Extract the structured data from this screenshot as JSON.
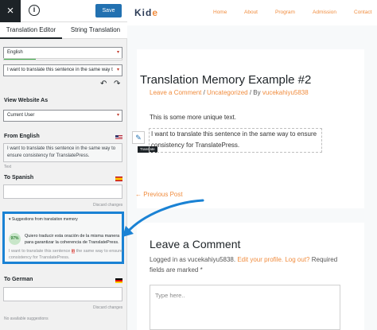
{
  "editor": {
    "close_icon": "×",
    "info_icon": "i",
    "save_label": "Save",
    "tabs": [
      {
        "label": "Translation Editor"
      },
      {
        "label": "String Translation"
      }
    ],
    "language_select": "English",
    "language_progress": 0.27,
    "string_select": "I want to translate this sentence in the same way t",
    "undo_icon": "↶",
    "redo_icon": "↷",
    "view_as_label": "View Website As",
    "view_as_value": "Current User",
    "from_label": "From English",
    "from_text": "I want to translate this sentence in the same way to ensure consistency for TranslatePress.",
    "from_type": "Text",
    "to_spanish_label": "To Spanish",
    "to_spanish_value": "",
    "discard_label": "Discard changes",
    "suggestions": {
      "title": "▾ Suggestions from translation memory",
      "percent": "97%",
      "translation": "Quiero traducir esta oración de la misma manera para garantizar la coherencia de TranslatePress.",
      "source_before": "I want to translate this sentence ",
      "source_highlight": "in",
      "source_after": " the same way to ensure consistency for TranslatePress."
    },
    "to_german_label": "To German",
    "to_german_value": "",
    "no_suggestions": "No available suggestions"
  },
  "site": {
    "logo_main": "Kid",
    "logo_accent": "e",
    "nav": [
      {
        "label": "Home"
      },
      {
        "label": "About"
      },
      {
        "label": "Program"
      },
      {
        "label": "Admission"
      },
      {
        "label": "Contact"
      }
    ],
    "post_title": "Translation Memory Example #2",
    "meta_comment": "Leave a Comment",
    "meta_sep1": " / ",
    "meta_category": "Uncategorized",
    "meta_sep2": " / By ",
    "meta_author": "vucekahiyu5838",
    "body_line1": "This is some more unique text.",
    "selected_text": "I want to translate this sentence in the same way to ensure consistency for TranslatePress.",
    "pencil_icon": "✎",
    "tooltip": "Translate",
    "prev_link": "← Previous Post",
    "comment_title": "Leave a Comment",
    "comment_note_prefix": "Logged in as vucekahiyu5838. ",
    "comment_edit_profile": "Edit your profile.",
    "comment_logout": "Log out?",
    "comment_note_suffix": " Required fields are marked *",
    "comment_placeholder": "Type here.."
  },
  "colors": {
    "accent": "#f08c3e",
    "highlight_border": "#1a82d4",
    "save": "#2271b1"
  }
}
